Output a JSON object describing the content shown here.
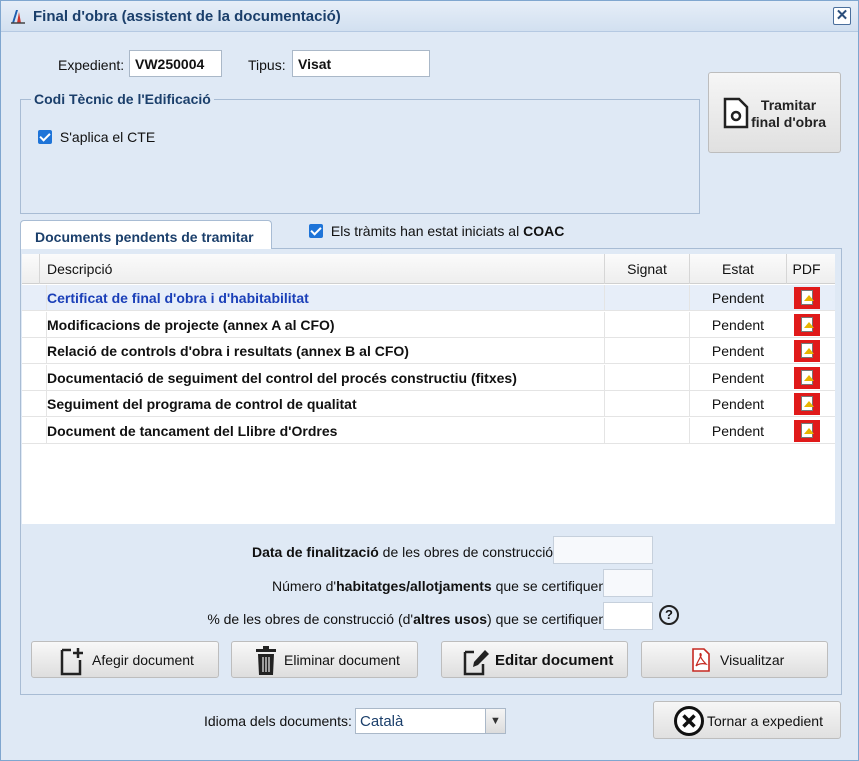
{
  "window": {
    "title": "Final d'obra (assistent de la documentació)",
    "close_label": "✕"
  },
  "header": {
    "expedient_label": "Expedient:",
    "expedient_value": "VW250004",
    "tipus_label": "Tipus:",
    "tipus_value": "Visat"
  },
  "cte": {
    "legend": "Codi Tècnic de l'Edificació",
    "checkbox_label": "S'aplica el CTE",
    "checked": true
  },
  "tramitar_button": {
    "line1": "Tramitar",
    "line2": "final d'obra"
  },
  "tabs": {
    "active_label": "Documents pendents de tramitar",
    "coac_prefix": "Els tràmits han estat iniciats al ",
    "coac_bold": "COAC"
  },
  "grid": {
    "columns": [
      "Descripció",
      "Signat",
      "Estat",
      "PDF"
    ],
    "rows": [
      {
        "descripcio": "Certificat de final d'obra i d'habitabilitat",
        "signat": "",
        "estat": "Pendent",
        "pdf": "pdf-icon"
      },
      {
        "descripcio": "Modificacions de projecte (annex A al CFO)",
        "signat": "",
        "estat": "Pendent",
        "pdf": "pdf-icon"
      },
      {
        "descripcio": "Relació de controls d'obra i resultats (annex B al CFO)",
        "signat": "",
        "estat": "Pendent",
        "pdf": "pdf-icon"
      },
      {
        "descripcio": "Documentació de seguiment del control del procés constructiu (fitxes)",
        "signat": "",
        "estat": "Pendent",
        "pdf": "pdf-icon"
      },
      {
        "descripcio": "Seguiment del programa de control de qualitat",
        "signat": "",
        "estat": "Pendent",
        "pdf": "pdf-icon"
      },
      {
        "descripcio": "Document de tancament del Llibre d'Ordres",
        "signat": "",
        "estat": "Pendent",
        "pdf": "pdf-icon"
      }
    ]
  },
  "form": {
    "data_bold": "Data de finalització",
    "data_rest": " de les obres de construcció:",
    "num_pre": "Número d'",
    "num_bold": "habitatges/allotjaments",
    "num_post": " que se certifiquen:",
    "pct_pre": "% de les obres de construcció (d'",
    "pct_bold": "altres usos",
    "pct_post": ") que se certifiquen:",
    "help": "?"
  },
  "actions": {
    "afegir": "Afegir document",
    "eliminar": "Eliminar document",
    "editar": "Editar document",
    "visualitzar": "Visualitzar"
  },
  "footer": {
    "idioma_label": "Idioma dels documents:",
    "idioma_value": "Català",
    "tornar": "Tornar a expedient"
  },
  "colors": {
    "accent": "#1b3f6b",
    "selected_link": "#1a3fb8",
    "pdf_red": "#e01a1a",
    "window_bg": "#dfe9f5"
  }
}
